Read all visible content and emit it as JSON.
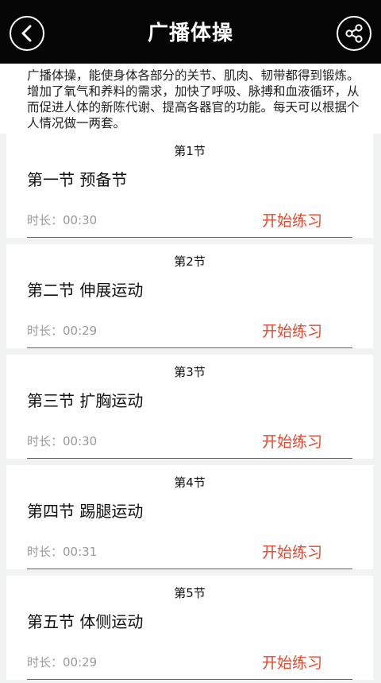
{
  "header": {
    "title": "广播体操",
    "back_icon": "chevron-left-icon",
    "share_icon": "share-icon"
  },
  "intro": {
    "text": "广播体操，能使身体各部分的关节、肌肉、韧带都得到锻炼。增加了氧气和养料的需求，加快了呼吸、脉搏和血液循环，从而促进人体的新陈代谢、提高各器官的功能。每天可以根据个人情况做一两套。"
  },
  "sections": [
    {
      "no": "第1节",
      "name": "第一节 预备节",
      "duration": "时长：00:30",
      "start_label": "开始练习"
    },
    {
      "no": "第2节",
      "name": "第二节 伸展运动",
      "duration": "时长：00:29",
      "start_label": "开始练习"
    },
    {
      "no": "第3节",
      "name": "第三节 扩胸运动",
      "duration": "时长：00:30",
      "start_label": "开始练习"
    },
    {
      "no": "第4节",
      "name": "第四节 踢腿运动",
      "duration": "时长：00:31",
      "start_label": "开始练习"
    },
    {
      "no": "第5节",
      "name": "第五节 体侧运动",
      "duration": "时长：00:29",
      "start_label": "开始练习"
    }
  ],
  "colors": {
    "header_bg": "#050505",
    "accent": "#e2492f",
    "muted": "#9a9a9a"
  }
}
